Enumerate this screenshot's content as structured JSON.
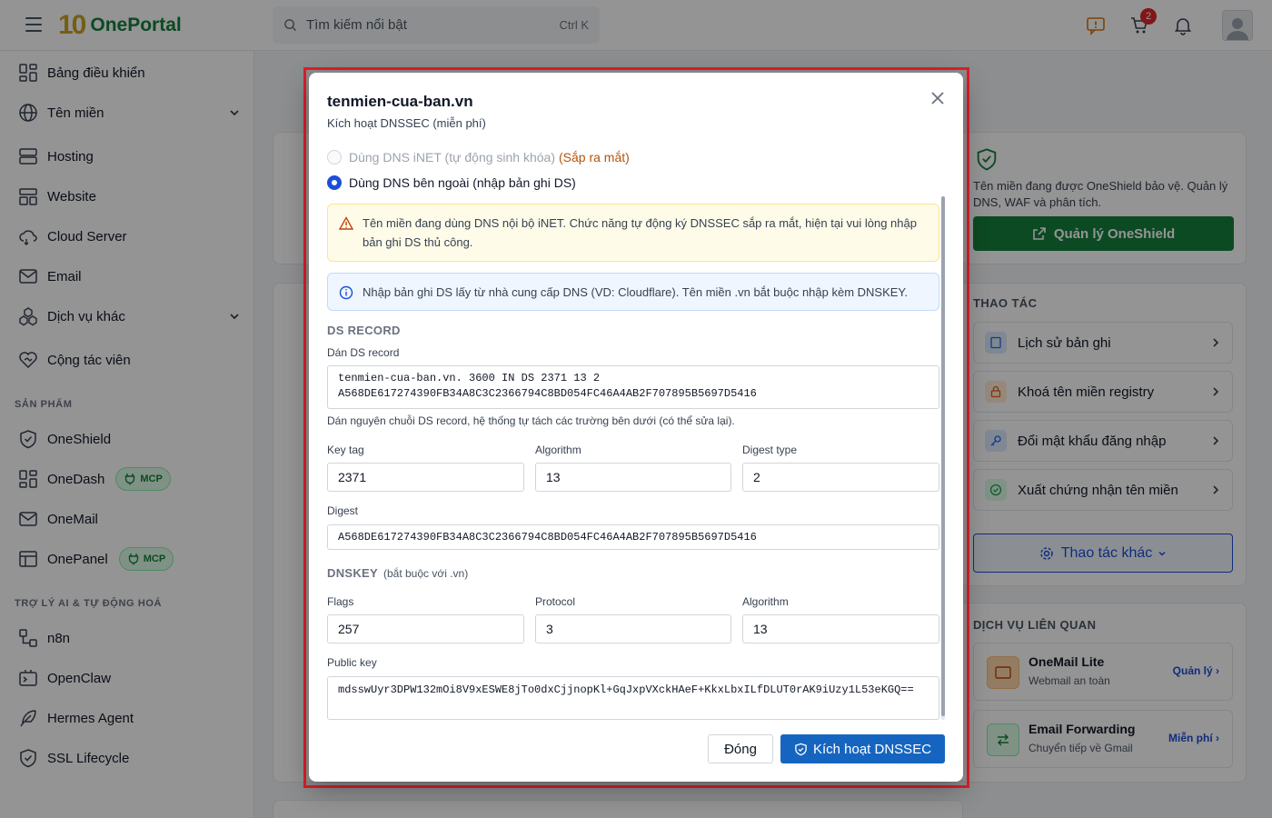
{
  "topbar": {
    "brand": "OnePortal",
    "logo_mark": "10",
    "search_placeholder": "Tìm kiếm nổi bật",
    "search_shortcut": "Ctrl K",
    "cart_count": "2"
  },
  "sidebar": {
    "items": [
      {
        "label": "Bảng điều khiển",
        "icon": "dashboard-icon"
      },
      {
        "label": "Tên miền",
        "icon": "globe-icon",
        "expandable": true
      },
      {
        "label": "Hosting",
        "icon": "server-icon"
      },
      {
        "label": "Website",
        "icon": "website-icon"
      },
      {
        "label": "Cloud Server",
        "icon": "cloud-icon"
      },
      {
        "label": "Email",
        "icon": "mail-icon"
      },
      {
        "label": "Dịch vụ khác",
        "icon": "cubes-icon",
        "expandable": true
      },
      {
        "label": "Cộng tác viên",
        "icon": "handshake-icon"
      }
    ],
    "section_products": "SẢN PHẨM",
    "products": [
      {
        "label": "OneShield",
        "icon": "shield-icon"
      },
      {
        "label": "OneDash",
        "icon": "dashboard-icon",
        "badge": "MCP"
      },
      {
        "label": "OneMail",
        "icon": "mail-icon"
      },
      {
        "label": "OnePanel",
        "icon": "panel-icon",
        "badge": "MCP"
      }
    ],
    "section_ai": "TRỢ LÝ AI & TỰ ĐỘNG HOÁ",
    "ai_items": [
      {
        "label": "n8n",
        "icon": "workflow-icon"
      },
      {
        "label": "OpenClaw",
        "icon": "terminal-icon"
      },
      {
        "label": "Hermes Agent",
        "icon": "feather-icon"
      },
      {
        "label": "SSL Lifecycle",
        "icon": "shield-check-icon"
      }
    ]
  },
  "background": {
    "oneshield_text": "Tên miền đang được OneShield bảo vệ. Quản lý DNS, WAF và phân tích.",
    "oneshield_button": "Quản lý OneShield",
    "actions_label": "THAO TÁC",
    "actions": [
      "Lịch sử bản ghi",
      "Khoá tên miền registry",
      "Đổi mật khẩu đăng nhập",
      "Xuất chứng nhận tên miền"
    ],
    "more_actions": "Thao tác khác",
    "related_label": "DỊCH VỤ LIÊN QUAN",
    "services": [
      {
        "name": "OneMail Lite",
        "desc": "Webmail an toàn",
        "action": "Quản lý ›"
      },
      {
        "name": "Email Forwarding",
        "desc": "Chuyển tiếp về Gmail",
        "action": "Miễn phí ›"
      }
    ],
    "colors": {
      "brand_green": "#15803d",
      "primary_blue": "#1565c0"
    }
  },
  "modal": {
    "title": "tenmien-cua-ban.vn",
    "subtitle": "Kích hoạt DNSSEC (miễn phí)",
    "option_inet": "Dùng DNS iNET (tự động sinh khóa)",
    "option_inet_tag": "(Sắp ra mắt)",
    "option_external": "Dùng DNS bên ngoài (nhập bản ghi DS)",
    "warning_text": "Tên miền đang dùng DNS nội bộ iNET. Chức năng tự động ký DNSSEC sắp ra mắt, hiện tại vui lòng nhập bản ghi DS thủ công.",
    "info_text": "Nhập bản ghi DS lấy từ nhà cung cấp DNS (VD: Cloudflare). Tên miền .vn bắt buộc nhập kèm DNSKEY.",
    "ds_section": "DS RECORD",
    "ds_paste_label": "Dán DS record",
    "ds_paste_value": "tenmien-cua-ban.vn. 3600 IN DS 2371 13 2\nA568DE617274390FB34A8C3C2366794C8BD054FC46A4AB2F707895B5697D5416",
    "ds_help": "Dán nguyên chuỗi DS record, hệ thống tự tách các trường bên dưới (có thể sửa lại).",
    "keytag_label": "Key tag",
    "keytag_value": "2371",
    "algorithm_label": "Algorithm",
    "algorithm_value": "13",
    "digest_type_label": "Digest type",
    "digest_type_value": "2",
    "digest_label": "Digest",
    "digest_value": "A568DE617274390FB34A8C3C2366794C8BD054FC46A4AB2F707895B5697D5416",
    "dnskey_section": "DNSKEY",
    "dnskey_note": "(bắt buộc với .vn)",
    "flags_label": "Flags",
    "flags_value": "257",
    "protocol_label": "Protocol",
    "protocol_value": "3",
    "dnskey_algorithm_label": "Algorithm",
    "dnskey_algorithm_value": "13",
    "pubkey_label": "Public key",
    "pubkey_value": "mdsswUyr3DPW132mOi8V9xESWE8jTo0dxCjjnopKl+GqJxpVXckHAeF+KkxLbxILfDLUT0rAK9iUzy1L53eKGQ==",
    "btn_close": "Đóng",
    "btn_activate": "Kích hoạt DNSSEC"
  }
}
